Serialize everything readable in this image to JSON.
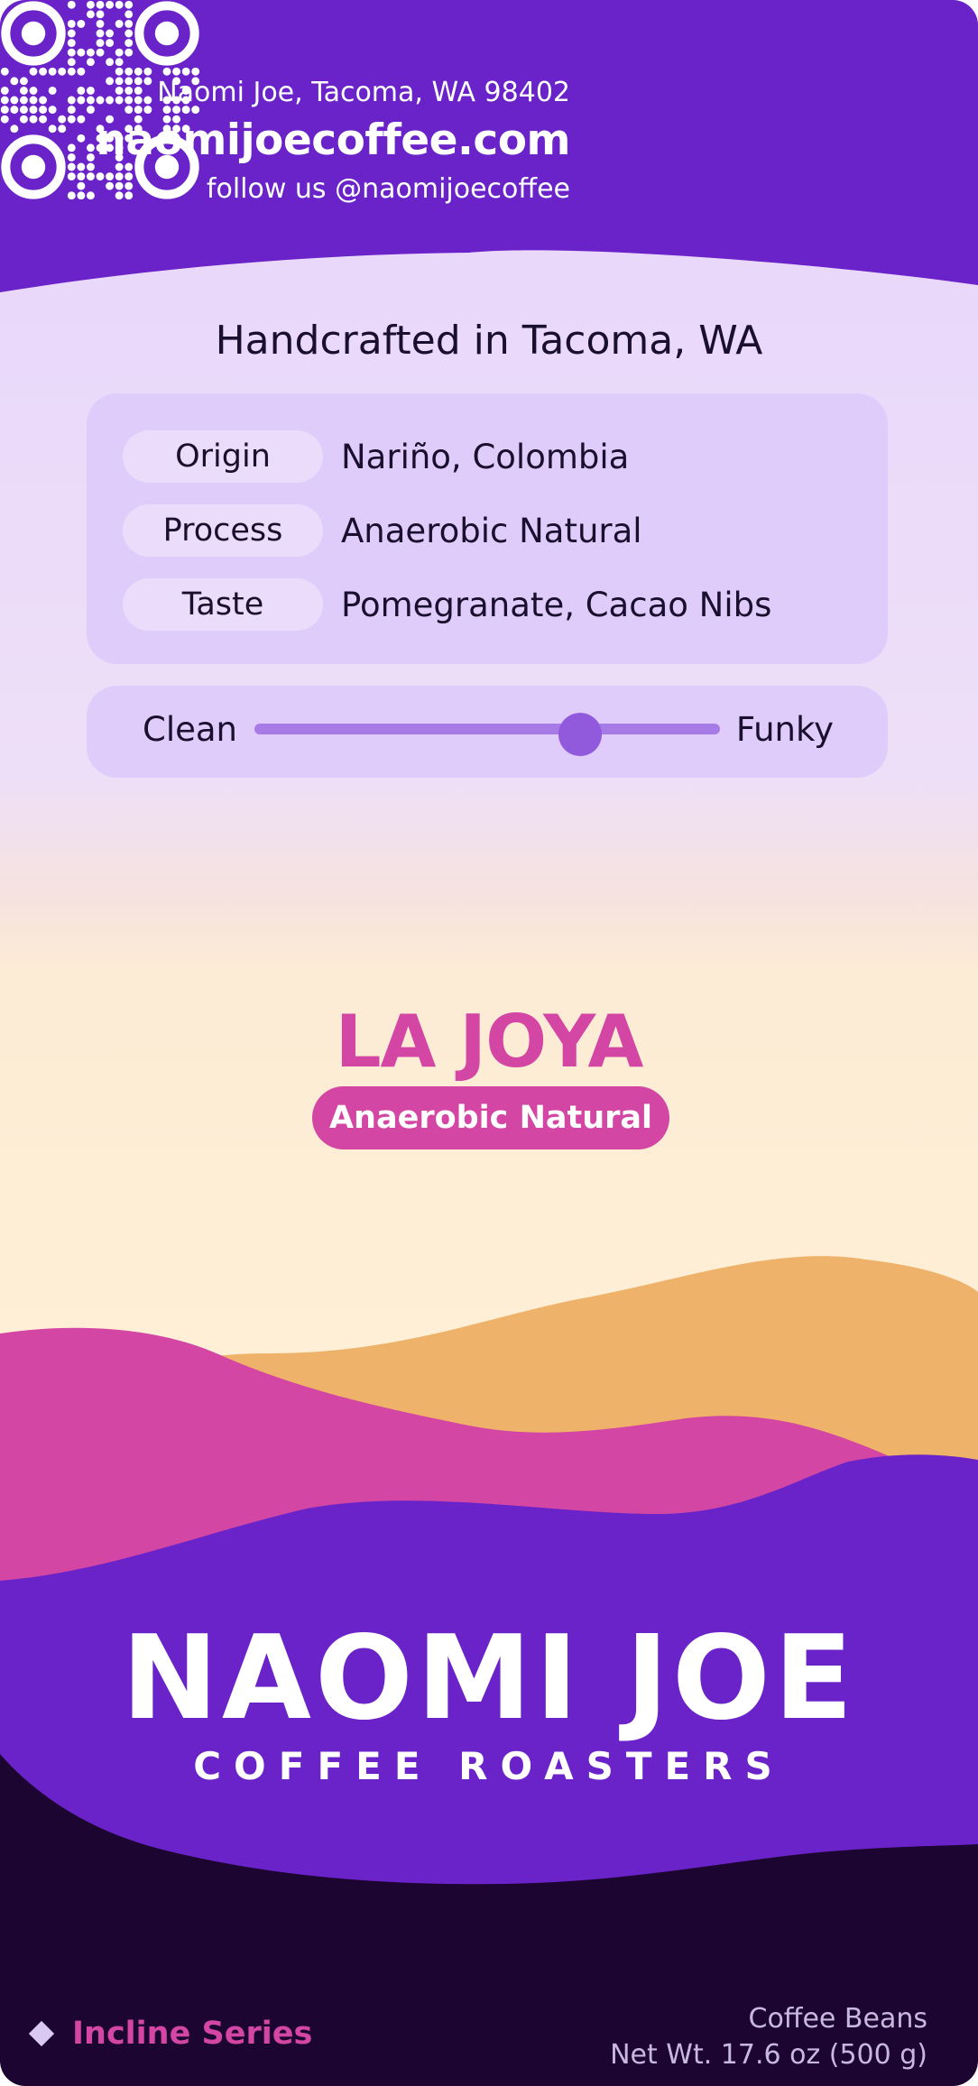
{
  "header": {
    "address": "Naomi Joe, Tacoma, WA 98402",
    "website": "naomijoecoffee.com",
    "social": "follow us @naomijoecoffee",
    "qr_icon": "qr-code-icon"
  },
  "info": {
    "tagline": "Handcrafted in Tacoma, WA",
    "rows": [
      {
        "label": "Origin",
        "value": "Nariño, Colombia"
      },
      {
        "label": "Process",
        "value": "Anaerobic Natural"
      },
      {
        "label": "Taste",
        "value": "Pomegranate, Cacao Nibs"
      }
    ]
  },
  "flavor_scale": {
    "left_label": "Clean",
    "right_label": "Funky",
    "level": 0.7
  },
  "product": {
    "name": "LA JOYA",
    "process_badge": "Anaerobic Natural"
  },
  "brand": {
    "name": "NAOMI JOE",
    "subtitle": "COFFEE ROASTERS"
  },
  "footer": {
    "series_icon": "diamond-icon",
    "series": "Incline Series",
    "product_type": "Coffee Beans",
    "net_weight": "Net Wt. 17.6 oz (500 g)"
  },
  "colors": {
    "purple": "#6a22c9",
    "magenta": "#d446a3",
    "orange": "#efb26a",
    "dark": "#1c0530",
    "lavender": "#dfccfa"
  }
}
